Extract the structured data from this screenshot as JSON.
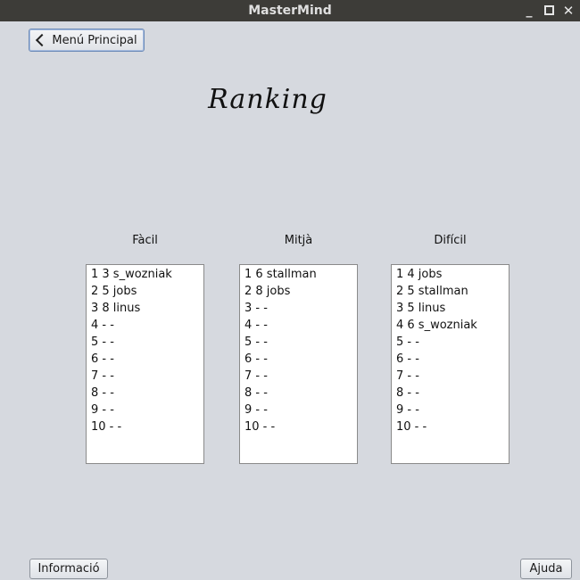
{
  "window": {
    "title": "MasterMind",
    "minimize_label": "_",
    "close_label": "✕"
  },
  "back_button": {
    "label": "Menú Principal",
    "icon": "chevron-left-icon"
  },
  "heading": "Ranking",
  "columns": [
    {
      "label": "Fàcil",
      "entries": [
        "1 3 s_wozniak",
        "2 5 jobs",
        "3 8 linus",
        "4 - -",
        "5 - -",
        "6 - -",
        "7 - -",
        "8 - -",
        "9 - -",
        "10 - -"
      ]
    },
    {
      "label": "Mitjà",
      "entries": [
        "1 6 stallman",
        "2 8 jobs",
        "3 - -",
        "4 - -",
        "5 - -",
        "6 - -",
        "7 - -",
        "8 - -",
        "9 - -",
        "10 - -"
      ]
    },
    {
      "label": "Difícil",
      "entries": [
        "1 4 jobs",
        "2 5 stallman",
        "3 5 linus",
        "4 6 s_wozniak",
        "5 - -",
        "6 - -",
        "7 - -",
        "8 - -",
        "9 - -",
        "10 - -"
      ]
    }
  ],
  "footer": {
    "info_label": "Informació",
    "help_label": "Ajuda"
  }
}
